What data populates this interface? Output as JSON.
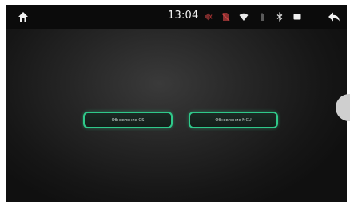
{
  "status_bar": {
    "time": "13:04",
    "icons": [
      "home-icon",
      "mute-icon",
      "no-sim-icon",
      "wifi-icon",
      "battery-icon",
      "bluetooth-icon",
      "screen-icon",
      "back-icon"
    ]
  },
  "buttons": {
    "os_update_label": "Обновление OS",
    "mcu_update_label": "Обновление MCU"
  },
  "colors": {
    "button_border": "#2fc98a",
    "status_bar_bg": "#0b0b0b",
    "screen_bg": "#252525"
  }
}
